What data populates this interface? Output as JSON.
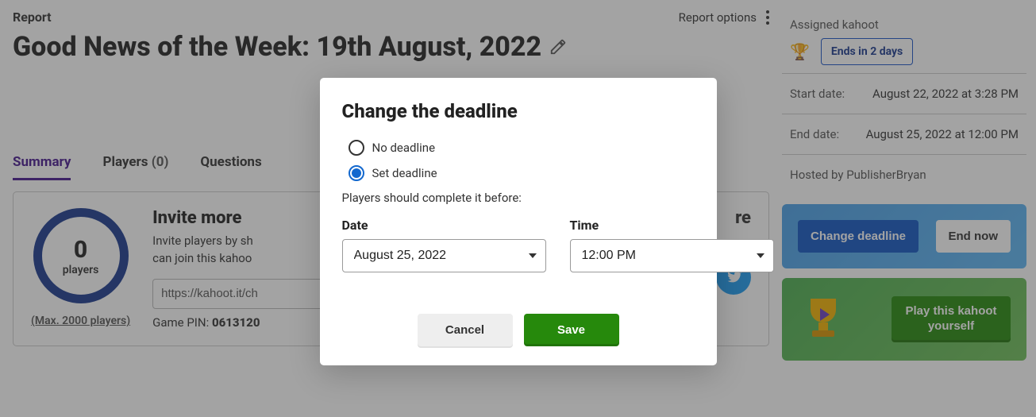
{
  "header": {
    "section_label": "Report",
    "title": "Good News of the Week: 19th August, 2022",
    "options_label": "Report options"
  },
  "tabs": {
    "summary": "Summary",
    "players": "Players",
    "players_count": "(0)",
    "questions": "Questions"
  },
  "summary": {
    "players_num": "0",
    "players_label": "players",
    "max_players": "(Max. 2000 players)",
    "invite_head": "Invite more",
    "invite_desc_line1": "Invite players by sh",
    "invite_desc_line2": "can join this kahoo",
    "invite_url": "https://kahoot.it/ch",
    "game_pin_label": "Game PIN: ",
    "game_pin": "0613120",
    "share_partial": "re"
  },
  "sidebar": {
    "assigned_label": "Assigned kahoot",
    "ends_chip": "Ends in 2 days",
    "start_date_label": "Start date:",
    "start_date_value": "August 22, 2022 at 3:28 PM",
    "end_date_label": "End date:",
    "end_date_value": "August 25, 2022 at 12:00 PM",
    "hosted_by": "Hosted by PublisherBryan",
    "change_deadline": "Change deadline",
    "end_now": "End now",
    "play_yourself": "Play this kahoot yourself"
  },
  "modal": {
    "title": "Change the deadline",
    "no_deadline": "No deadline",
    "set_deadline": "Set deadline",
    "hint": "Players should complete it before:",
    "date_label": "Date",
    "time_label": "Time",
    "date_value": "August 25, 2022",
    "time_value": "12:00 PM",
    "cancel": "Cancel",
    "save": "Save"
  }
}
